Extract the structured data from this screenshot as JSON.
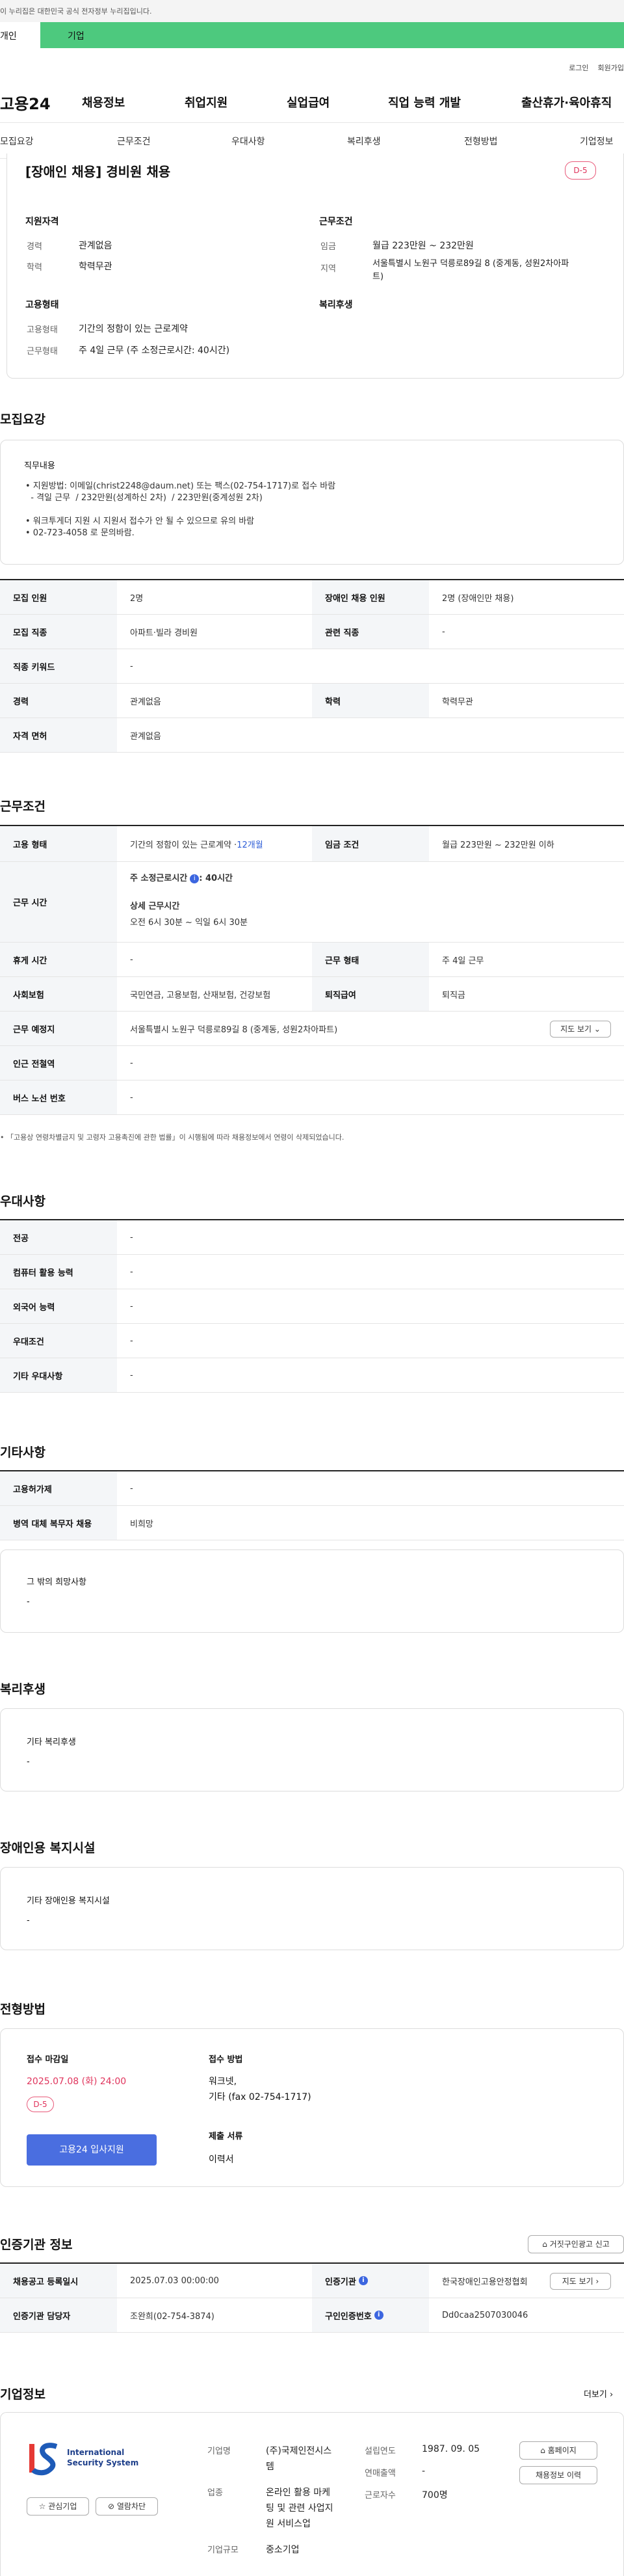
{
  "gov_banner": "이 누리집은 대한민국 공식 전자정부 누리집입니다.",
  "top_tabs": {
    "person": "개인",
    "corp": "기업"
  },
  "util": {
    "login": "로그인",
    "join": "회원가입"
  },
  "gnb": {
    "logo": "고용24",
    "menus": [
      "채용정보",
      "취업지원",
      "실업급여",
      "직업 능력 개발",
      "출산휴가·육아휴직"
    ]
  },
  "lnb": [
    "모집요강",
    "근무조건",
    "우대사항",
    "복리후생",
    "전형방법",
    "기업정보"
  ],
  "title_card": {
    "title": "[장애인 채용] 경비원 채용",
    "dday": "D-5",
    "qual_h": "지원자격",
    "career_k": "경력",
    "career_v": "관계없음",
    "edu_k": "학력",
    "edu_v": "학력무관",
    "work_h": "근무조건",
    "wage_k": "임금",
    "wage_v": "월급 223만원 ~ 232만원",
    "area_k": "지역",
    "area_v1": "서울특별시 노원구 덕릉로89길 8 (중계동, 성원2차아파",
    "area_v2": "트)",
    "emp_h": "고용형태",
    "emptype_k": "고용형태",
    "emptype_v": "기간의 정함이 있는 근로계약",
    "worktype_k": "근무형태",
    "worktype_v": "주 4일 근무 (주 소정근로시간: 40시간)",
    "welfare_h": "복리후생"
  },
  "recruit": {
    "heading": "모집요강",
    "duty_h": "직무내용",
    "duty_lines": [
      "• 지원방법: 이메일(christ2248@daum.net) 또는 팩스(02-754-1717)로 접수 바람",
      "  - 격일 근무  / 232만원(성계하신 2차)  / 223만원(중계성원 2차)",
      "",
      "• 워크투게더 지원 시 지원서 접수가 안 될 수 있으므로 유의 바람",
      "• 02-723-4058 로 문의바람."
    ],
    "rows": [
      {
        "k1": "모집 인원",
        "v1": "2명",
        "k2": "장애인 채용 인원",
        "v2": "2명 (장애인만 채용)"
      },
      {
        "k1": "모집 직종",
        "v1": "아파트·빌라 경비원",
        "k2": "관련 직종",
        "v2": "-"
      },
      {
        "k1": "직종 키워드",
        "v1": "-"
      },
      {
        "k1": "경력",
        "v1": "관계없음",
        "k2": "학력",
        "v2": "학력무관"
      },
      {
        "k1": "자격 면허",
        "v1": "관계없음"
      }
    ]
  },
  "work": {
    "heading": "근무조건",
    "emp_k": "고용 형태",
    "emp_v": "기간의 정함이 있는 근로계약 · ",
    "emp_v_link": "12개월",
    "wage_k": "임금 조건",
    "wage_v": "월급 223만원 ~ 232만원 이하",
    "time_k": "근무 시간",
    "time_main": "주 소정근로시간",
    "time_main_v": ": 40시간",
    "time_detail_h": "상세 근무시간",
    "time_detail_v": "오전 6시 30분 ~ 익일 6시 30분",
    "rows": [
      {
        "k1": "휴게 시간",
        "v1": "-",
        "k2": "근무 형태",
        "v2": "주 4일 근무"
      },
      {
        "k1": "사회보험",
        "v1": "국민연금, 고용보험, 산재보험, 건강보험",
        "k2": "퇴직급여",
        "v2": "퇴직금"
      }
    ],
    "place_k": "근무 예정지",
    "place_v": "서울특별시 노원구 덕릉로89길 8 (중계동, 성원2차아파트)",
    "map_btn": "지도 보기",
    "subway_k": "인근 전철역",
    "subway_v": "-",
    "bus_k": "버스 노선 번호",
    "bus_v": "-",
    "note": "• 「고용상 연령차별금지 및 고령자 고용촉진에 관한 법률」이 시행됨에 따라 채용정보에서 연령이 삭제되었습니다."
  },
  "pref": {
    "heading": "우대사항",
    "rows": [
      {
        "k": "전공",
        "v": "-"
      },
      {
        "k": "컴퓨터 활용 능력",
        "v": "-"
      },
      {
        "k": "외국어 능력",
        "v": "-"
      },
      {
        "k": "우대조건",
        "v": "-"
      },
      {
        "k": "기타 우대사항",
        "v": "-"
      }
    ]
  },
  "etc": {
    "heading": "기타사항",
    "rows": [
      {
        "k": "고용허가제",
        "v": "-"
      },
      {
        "k": "병역 대체 복무자 채용",
        "v": "비희망"
      }
    ],
    "other_h": "그 밖의 희망사항",
    "other_v": "-"
  },
  "welfare": {
    "heading": "복리후생",
    "h": "기타 복리후생",
    "v": "-"
  },
  "facility": {
    "heading": "장애인용 복지시설",
    "h": "기타 장애인용 복지시설",
    "v": "-"
  },
  "selection": {
    "heading": "전형방법",
    "deadline_h": "접수 마감일",
    "deadline_v": "2025.07.08 (화) 24:00",
    "dday": "D-5",
    "apply_btn": "고용24 입사지원",
    "method_h": "접수 방법",
    "method_v1": "워크넷,",
    "method_v2": "기타 (fax 02-754-1717)",
    "docs_h": "제출 서류",
    "docs_v": "이력서"
  },
  "cert": {
    "heading": "인증기관 정보",
    "report_btn": "거짓구인광고 신고",
    "r1": {
      "k1": "채용공고 등록일시",
      "v1": "2025.07.03 00:00:00",
      "k2": "인증기관",
      "v2": "한국장애인고용안정협회",
      "btn": "지도 보기"
    },
    "r2": {
      "k1": "인증기관 담당자",
      "v1": "조완희(02-754-3874)",
      "k2": "구인인증번호",
      "v2": "Dd0caa2507030046"
    }
  },
  "company": {
    "heading": "기업정보",
    "more": "더보기",
    "logo_line1": "International",
    "logo_line2": "Security System",
    "interest_btn": "관심기업",
    "block_btn": "열람차단",
    "name_k": "기업명",
    "name_v1": "(주)국제인전시스",
    "name_v2": "템",
    "biz_k": "업종",
    "biz_v1": "온라인 활용 마케",
    "biz_v2": "팅 및 관련 사업지",
    "biz_v3": "원 서비스업",
    "size_k": "기업규모",
    "size_v": "중소기업",
    "est_k": "설립연도",
    "est_v": "1987. 09. 05",
    "sales_k": "연매출액",
    "sales_v": "-",
    "emp_k": "근로자수",
    "emp_v": "700명",
    "home_btn": "홈페이지",
    "jobs_btn": "채용정보 이력"
  },
  "colors": {
    "accent_green": "#4dc97e",
    "apply_blue": "#4a6ee0",
    "dday_pink": "#e0345c"
  }
}
